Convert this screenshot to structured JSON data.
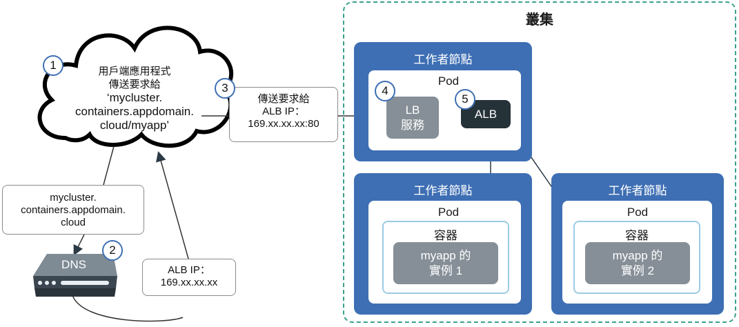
{
  "cluster": {
    "title": "叢集"
  },
  "client": {
    "lines": [
      "用戶端應用程式",
      "傳送要求給"
    ],
    "url_lines": [
      "‘mycluster.",
      "containers.appdomain.",
      "cloud/myapp’"
    ]
  },
  "steps": [
    "1",
    "2",
    "3",
    "4",
    "5"
  ],
  "dns_query": {
    "lines": [
      "mycluster.",
      "containers.appdomain.",
      "cloud"
    ]
  },
  "dns": {
    "label": "DNS"
  },
  "dns_reply": {
    "lines": [
      "ALB IP：",
      "169.xx.xx.xx"
    ]
  },
  "request_note": {
    "lines": [
      "傳送要求給",
      "ALB IP：",
      "169.xx.xx.xx:80"
    ]
  },
  "worker_nodes": [
    {
      "title": "工作者節點",
      "pod": "Pod",
      "lb": [
        "LB",
        "服務"
      ],
      "alb": "ALB"
    },
    {
      "title": "工作者節點",
      "pod": "Pod",
      "container": "容器",
      "instance": [
        "myapp 的",
        "實例 1"
      ]
    },
    {
      "title": "工作者節點",
      "pod": "Pod",
      "container": "容器",
      "instance": [
        "myapp 的",
        "實例 2"
      ]
    }
  ],
  "colors": {
    "worker": "#3e6fb4",
    "cluster_border": "#3aa08a",
    "alb": "#253238",
    "service": "#868f97"
  }
}
